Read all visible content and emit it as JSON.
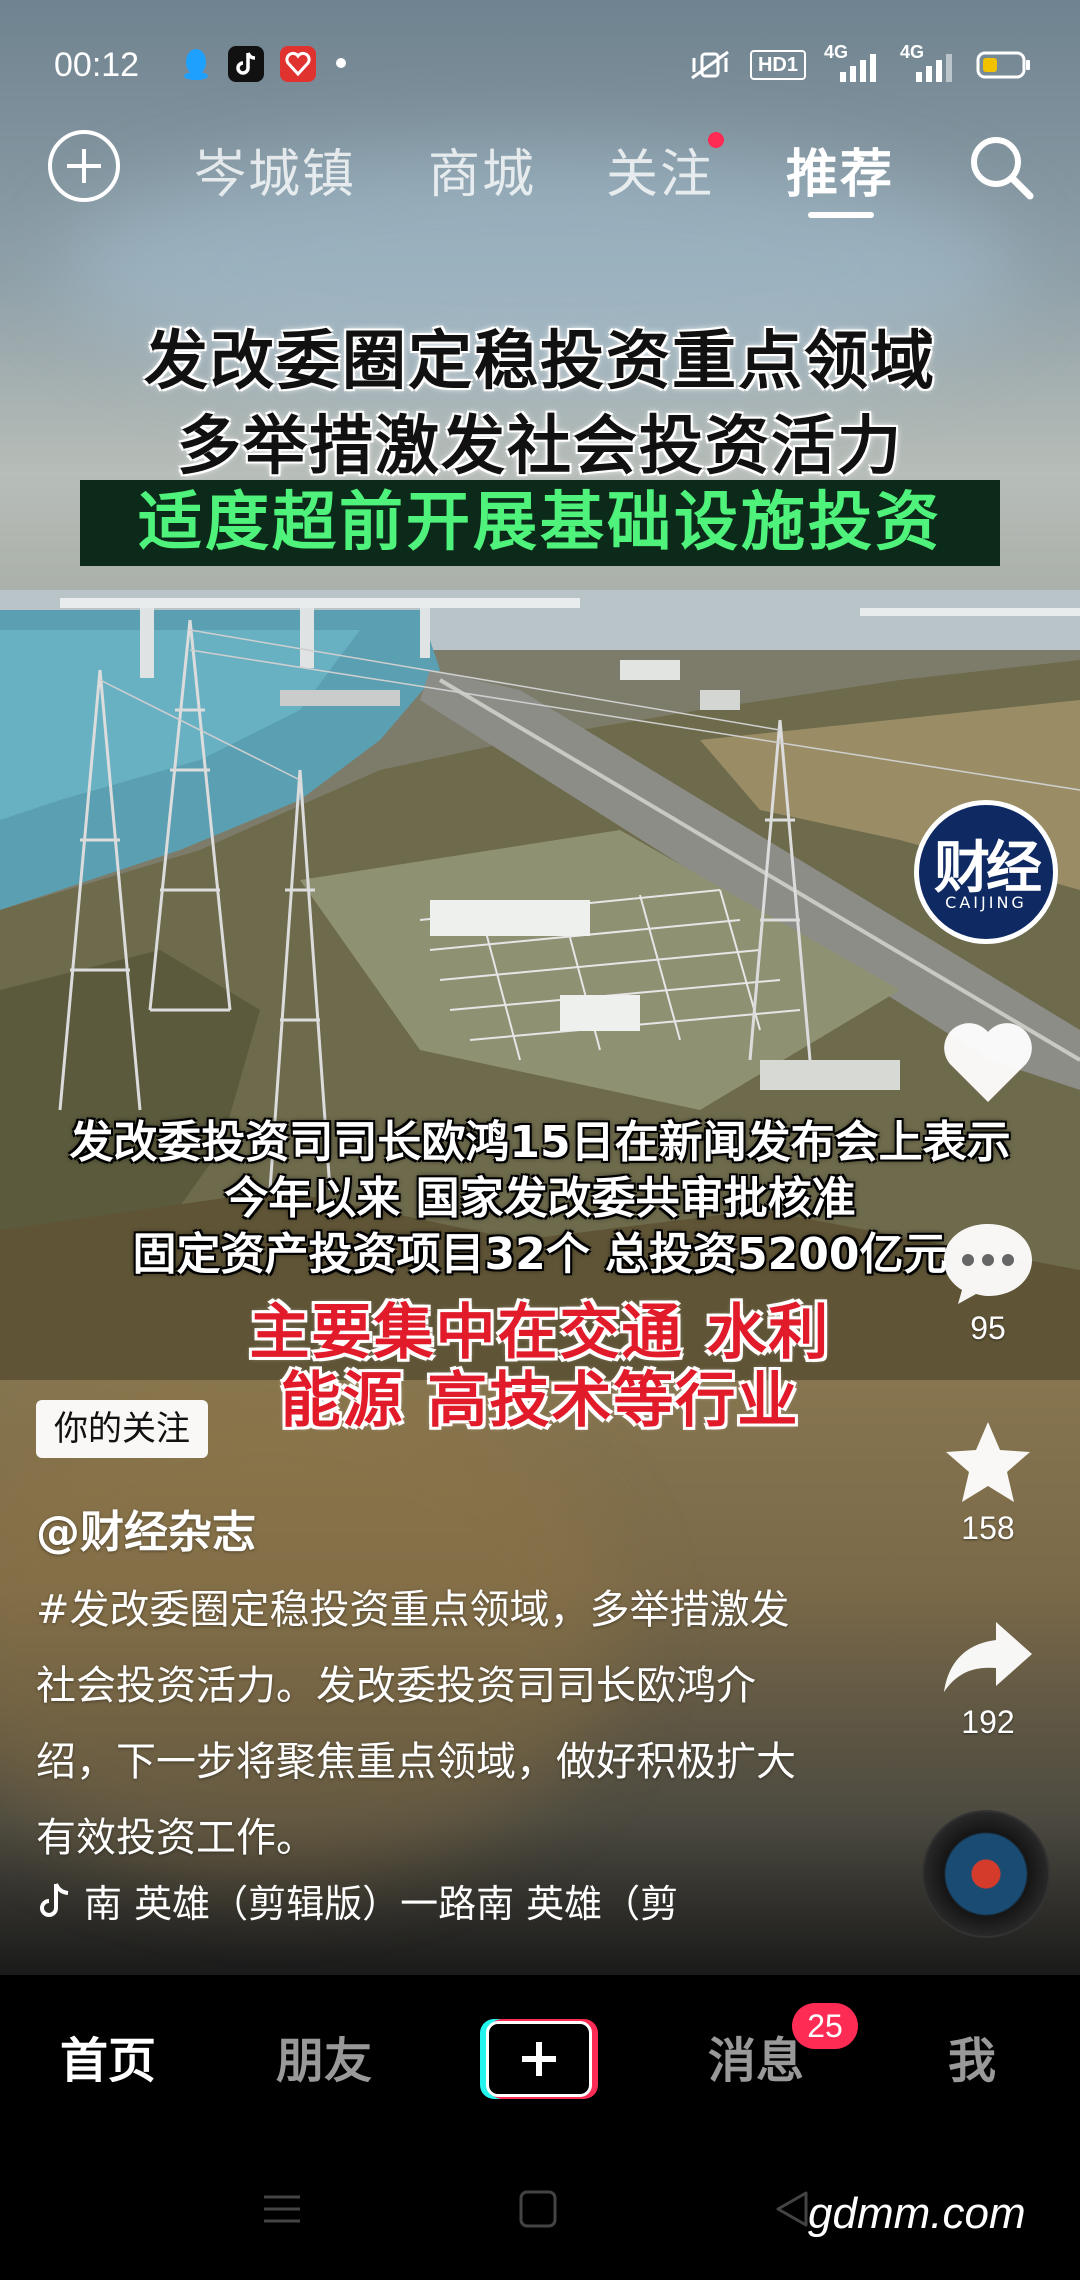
{
  "status_bar": {
    "time": "00:12",
    "app_icons": [
      "qq-icon",
      "tiktok-icon",
      "app-icon"
    ],
    "right_icons": [
      "vibrate-off-icon",
      "hd-icon",
      "signal-4g-icon",
      "signal-4g-icon",
      "battery-icon"
    ],
    "hd_label": "HD1",
    "net1": "4G",
    "net2": "4G"
  },
  "top_nav": {
    "tabs": [
      {
        "label": "岑城镇",
        "active": false
      },
      {
        "label": "商城",
        "active": false
      },
      {
        "label": "关注",
        "active": false,
        "dot": true
      },
      {
        "label": "推荐",
        "active": true
      }
    ]
  },
  "video": {
    "headline_lines": [
      "发改委圈定稳投资重点领域",
      "多举措激发社会投资活力"
    ],
    "headline_green": "适度超前开展基础设施投资",
    "subtitle_lines": [
      "发改委投资司司长欧鸿15日在新闻发布会上表示",
      "今年以来 国家发改委共审批核准",
      "固定资产投资项目32个 总投资5200亿元"
    ],
    "highlight_lines": [
      "主要集中在交通 水利",
      "能源 高技术等行业"
    ]
  },
  "side_actions": {
    "avatar_text": "财经",
    "avatar_subtext": "CAIJING",
    "like_count": "",
    "comment_count": "95",
    "favorite_count": "158",
    "share_count": "192"
  },
  "post": {
    "follow_badge": "你的关注",
    "author": "@财经杂志",
    "description": "#发改委圈定稳投资重点领域，多举措激发社会投资活力。发改委投资司司长欧鸿介绍，下一步将聚焦重点领域，做好积极扩大有效投资工作。",
    "music": "南    英雄（剪辑版）一路南    英雄（剪"
  },
  "tab_bar": {
    "items": [
      "首页",
      "朋友",
      "消息",
      "我"
    ],
    "messages_badge": "25"
  },
  "system_nav": {
    "watermark": "gdmm.com"
  },
  "colors": {
    "accent_red": "#fe2c55",
    "accent_cyan": "#25f4ee",
    "headline_green": "#4ff27a",
    "highlight_red": "#e21b2a"
  }
}
